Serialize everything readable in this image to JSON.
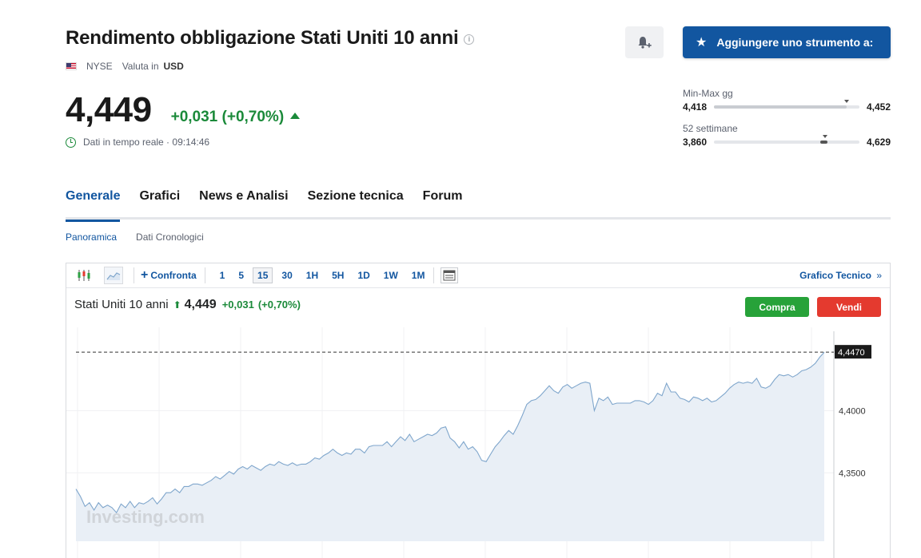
{
  "header": {
    "title": "Rendimento obbligazione Stati Uniti 10 anni",
    "exchange": "NYSE",
    "currency_label": "Valuta in",
    "currency": "USD",
    "price": "4,449",
    "change": "+0,031 (+0,70%)",
    "realtime_label": "Dati in tempo reale",
    "time": "09:14:46",
    "add_button": "Aggiungere uno strumento a:"
  },
  "ranges": {
    "day": {
      "label": "Min-Max gg",
      "low": "4,418",
      "high": "4,452",
      "marker": 0.91
    },
    "week52": {
      "label": "52 settimane",
      "low": "3,860",
      "high": "4,629",
      "marker": 0.766
    }
  },
  "tabs": [
    {
      "label": "Generale",
      "active": true
    },
    {
      "label": "Grafici"
    },
    {
      "label": "News e Analisi"
    },
    {
      "label": "Sezione tecnica"
    },
    {
      "label": "Forum"
    }
  ],
  "subtabs": [
    {
      "label": "Panoramica",
      "active": true
    },
    {
      "label": "Dati Cronologici"
    }
  ],
  "toolbar": {
    "compare": "Confronta",
    "periods": [
      "1",
      "5",
      "15",
      "30",
      "1H",
      "5H",
      "1D",
      "1W",
      "1M"
    ],
    "active_period": "15",
    "technical_chart": "Grafico Tecnico",
    "technical_chevron": "»"
  },
  "instrument": {
    "name": "Stati Uniti 10 anni",
    "price": "4,449",
    "change": "+0,031",
    "change_pct": "(+0,70%)",
    "buy": "Compra",
    "sell": "Vendi"
  },
  "chart_data": {
    "type": "area",
    "y_ticks": [
      "4,4000",
      "4,3500"
    ],
    "y_tick_values": [
      4.4,
      4.35
    ],
    "current_label": "4,4470",
    "current_value": 4.447,
    "ylim": [
      4.295,
      4.467
    ],
    "watermark": "Investing.com",
    "values": [
      4.337,
      4.331,
      4.323,
      4.326,
      4.32,
      4.326,
      4.322,
      4.324,
      4.322,
      4.318,
      4.325,
      4.322,
      4.327,
      4.322,
      4.326,
      4.325,
      4.327,
      4.33,
      4.325,
      4.329,
      4.334,
      4.334,
      4.337,
      4.334,
      4.339,
      4.339,
      4.341,
      4.341,
      4.34,
      4.342,
      4.344,
      4.347,
      4.345,
      4.348,
      4.351,
      4.349,
      4.353,
      4.355,
      4.353,
      4.356,
      4.354,
      4.352,
      4.355,
      4.357,
      4.356,
      4.359,
      4.357,
      4.356,
      4.358,
      4.356,
      4.357,
      4.357,
      4.359,
      4.362,
      4.361,
      4.364,
      4.366,
      4.369,
      4.366,
      4.364,
      4.366,
      4.365,
      4.369,
      4.369,
      4.366,
      4.371,
      4.372,
      4.372,
      4.372,
      4.375,
      4.371,
      4.375,
      4.379,
      4.376,
      4.381,
      4.375,
      4.377,
      4.379,
      4.381,
      4.38,
      4.382,
      4.386,
      4.387,
      4.378,
      4.375,
      4.37,
      4.375,
      4.369,
      4.371,
      4.367,
      4.36,
      4.359,
      4.365,
      4.371,
      4.375,
      4.38,
      4.384,
      4.381,
      4.388,
      4.396,
      4.405,
      4.408,
      4.409,
      4.412,
      4.416,
      4.42,
      4.416,
      4.414,
      4.419,
      4.421,
      4.418,
      4.42,
      4.422,
      4.423,
      4.422,
      4.4,
      4.41,
      4.408,
      4.411,
      4.405,
      4.406,
      4.406,
      4.406,
      4.406,
      4.408,
      4.408,
      4.407,
      4.405,
      4.408,
      4.414,
      4.412,
      4.422,
      4.415,
      4.415,
      4.41,
      4.409,
      4.407,
      4.411,
      4.41,
      4.408,
      4.41,
      4.407,
      4.408,
      4.411,
      4.414,
      4.418,
      4.421,
      4.423,
      4.422,
      4.423,
      4.422,
      4.426,
      4.419,
      4.418,
      4.42,
      4.425,
      4.429,
      4.428,
      4.429,
      4.427,
      4.429,
      4.432,
      4.433,
      4.435,
      4.438,
      4.443,
      4.447
    ]
  },
  "colors": {
    "brand_blue": "#1256a0",
    "positive": "#1b8a3a",
    "buy": "#27a239",
    "sell": "#e43a2f",
    "line": "#7fa6cc",
    "area": "#e9eff6"
  }
}
